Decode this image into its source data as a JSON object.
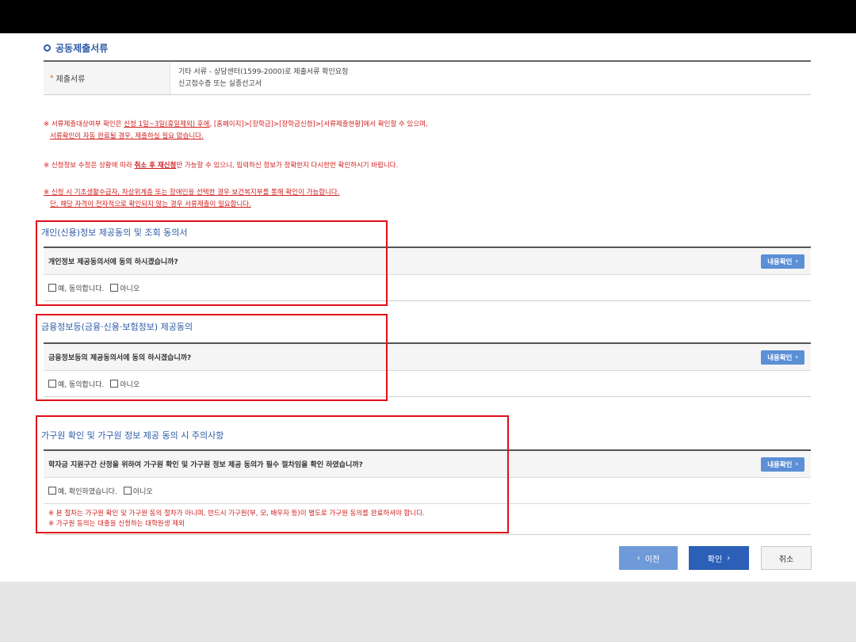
{
  "section": {
    "title": "공동제출서류",
    "docs_label": "제출서류",
    "docs_line1": "기타 서류 - 상담센터(1599-2000)로 제출서류 확인요청",
    "docs_line2": "신고접수증 또는 실종선고서"
  },
  "notices": {
    "n1_a": "※ 서류제출대상여부 확인은 ",
    "n1_b": "신청 1일~3일(휴일제외) 후에",
    "n1_c": ", [홈페이지]>[장학금]>[장학금신청]>[서류제출현황]에서 확인할 수 있으며,",
    "n1_d": "서류확인이 자동 완료될 경우, 제출하실 필요 없습니다.",
    "n2_a": "※ 신청정보 수정은 상황에 따라 ",
    "n2_b": "취소 후 재신청",
    "n2_c": "만 가능할 수 있으니, 입력하신 정보가 정확한지 다시한번 확인하시기 바랍니다.",
    "n3_a": "※ 신청 시 기초생활수급자, 차상위계층 또는 장애인을 선택한 경우 보건복지부를 통해 확인이 가능합니다.",
    "n3_b": "단, 해당 자격이 전자적으로 확인되지 않는 경우 서류제출이 필요합니다."
  },
  "consents": [
    {
      "title": "개인(신용)정보 제공동의 및 조회 동의서",
      "question": "개인정보 제공동의서에 동의 하시겠습니까?",
      "yes": "예, 동의합니다.",
      "no": "아니오",
      "detail": "내용확인"
    },
    {
      "title": "금융정보등(금융·신용·보험정보) 제공동의",
      "question": "금융정보등의 제공동의서에 동의 하시겠습니까?",
      "yes": "예, 동의합니다.",
      "no": "아니오",
      "detail": "내용확인"
    },
    {
      "title": "가구원 확인 및 가구원 정보 제공 동의 시 주의사항",
      "question": "학자금 지원구간 산정을 위하여 가구원 확인 및 가구원 정보 제공 동의가 필수 절차임을 확인 하였습니까?",
      "yes": "예, 확인하였습니다.",
      "no": "아니오",
      "detail": "내용확인",
      "note1": "※ 본 절차는 가구원 확인 및 가구원 동의 절차가 아니며, 반드시 가구원(부, 모, 배우자 등)이 별도로 가구원 동의를 완료하셔야 합니다.",
      "note2": "※ 가구원 동의는 대출을 신청하는 대학원생 제외"
    }
  ],
  "buttons": {
    "prev": "이전",
    "confirm": "확인",
    "cancel": "취소"
  },
  "colors": {
    "accent": "#2b5aa6",
    "notice": "#d0201f",
    "highlight": "#e0101a"
  }
}
